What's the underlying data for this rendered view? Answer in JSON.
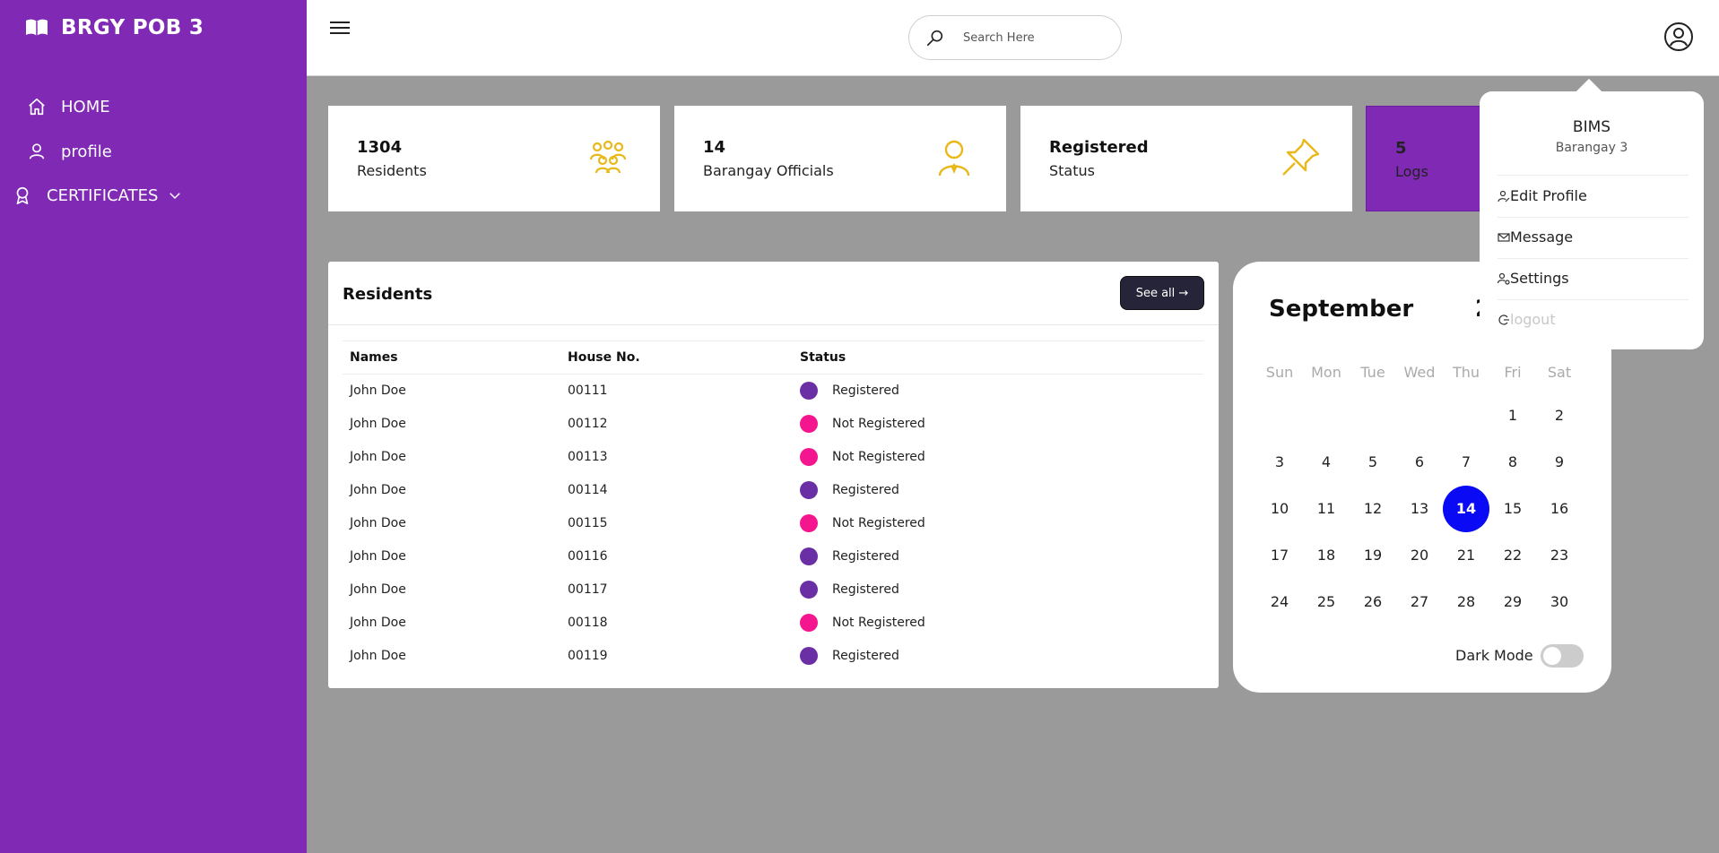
{
  "sidebar": {
    "brand": "BRGY POB 3",
    "items": [
      {
        "label": "HOME"
      },
      {
        "label": "profile"
      },
      {
        "label": "CERTIFICATES"
      }
    ]
  },
  "topbar": {
    "search_placeholder": "Search Here"
  },
  "cards": [
    {
      "value": "1304",
      "label": "Residents"
    },
    {
      "value": "14",
      "label": "Barangay Officials"
    },
    {
      "value": "Registered",
      "label": "Status"
    },
    {
      "value": "5",
      "label": "Logs"
    }
  ],
  "residents": {
    "title": "Residents",
    "see_all": "See all →",
    "headers": [
      "Names",
      "House No.",
      "Status"
    ],
    "rows": [
      {
        "name": "John Doe",
        "house": "00111",
        "status": "Registered"
      },
      {
        "name": "John Doe",
        "house": "00112",
        "status": "Not Registered"
      },
      {
        "name": "John Doe",
        "house": "00113",
        "status": "Not Registered"
      },
      {
        "name": "John Doe",
        "house": "00114",
        "status": "Registered"
      },
      {
        "name": "John Doe",
        "house": "00115",
        "status": "Not Registered"
      },
      {
        "name": "John Doe",
        "house": "00116",
        "status": "Registered"
      },
      {
        "name": "John Doe",
        "house": "00117",
        "status": "Registered"
      },
      {
        "name": "John Doe",
        "house": "00118",
        "status": "Not Registered"
      },
      {
        "name": "John Doe",
        "house": "00119",
        "status": "Registered"
      }
    ]
  },
  "calendar": {
    "month": "September",
    "year_partial": "2",
    "weekdays": [
      "Sun",
      "Mon",
      "Tue",
      "Wed",
      "Thu",
      "Fri",
      "Sat"
    ],
    "first_weekday_index": 5,
    "days_in_month": 30,
    "today": 14,
    "dark_mode_label": "Dark Mode"
  },
  "dropdown": {
    "name": "BIMS",
    "subtitle": "Barangay 3",
    "items": [
      "Edit Profile",
      "Message",
      "Settings",
      "logout"
    ]
  },
  "colors": {
    "sidebar": "#7f29b5",
    "accent_icon": "#e9b81a",
    "registered": "#6b2fa5",
    "not_registered": "#f4168f",
    "today": "#0a0af5"
  }
}
